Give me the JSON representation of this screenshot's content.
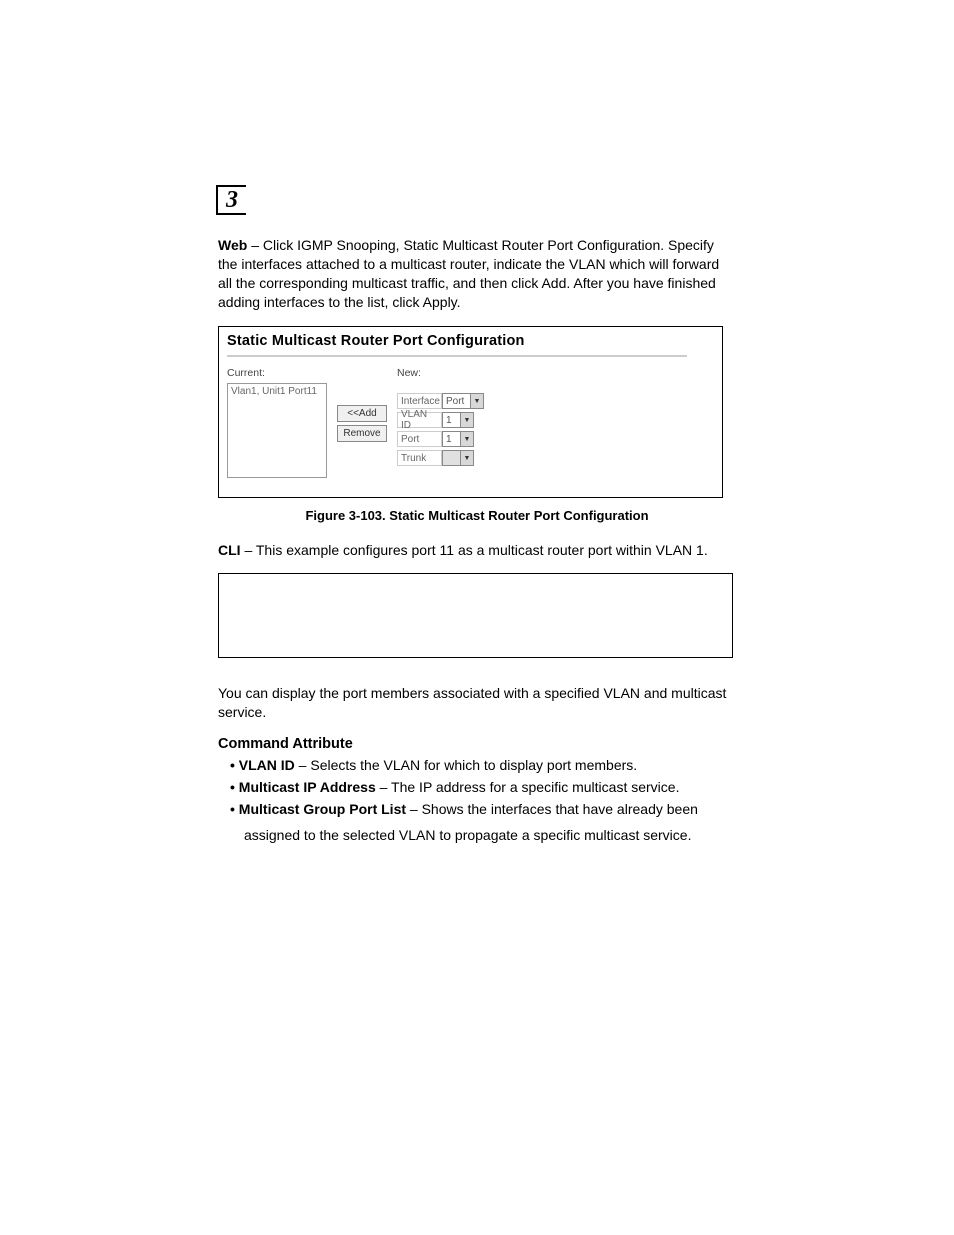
{
  "chapter_number": "3",
  "web_paragraph": {
    "prefix": "Web",
    "text": " – Click IGMP Snooping, Static Multicast Router Port Configuration. Specify the interfaces attached to a multicast router, indicate the VLAN which will forward all the corresponding multicast traffic, and then click Add. After you have finished adding interfaces to the list, click Apply."
  },
  "screenshot": {
    "title": "Static Multicast Router Port Configuration",
    "current_label": "Current:",
    "list_item": "Vlan1, Unit1 Port11",
    "add_button": "<<Add",
    "remove_button": "Remove",
    "new_label": "New:",
    "rows": {
      "interface": {
        "label": "Interface",
        "value": "Port"
      },
      "vlan_id": {
        "label": "VLAN ID",
        "value": "1"
      },
      "port": {
        "label": "Port",
        "value": "1"
      },
      "trunk": {
        "label": "Trunk",
        "value": ""
      }
    }
  },
  "figure_caption": "Figure 3-103.  Static Multicast Router Port Configuration",
  "cli_paragraph": {
    "prefix": "CLI",
    "text": " – This example configures port 11 as a multicast router port within VLAN 1."
  },
  "display_paragraph": "You can display the port members associated with a specified VLAN and multicast service.",
  "command_attribute_heading": "Command Attribute",
  "bullets": {
    "b1": {
      "label": "VLAN ID",
      "text": " – Selects the VLAN for which to display port members."
    },
    "b2": {
      "label": "Multicast IP Address",
      "text": " – The IP address for a specific multicast service."
    },
    "b3": {
      "label": "Multicast Group Port List",
      "text": " – Shows the interfaces that have already been",
      "cont": "assigned to the selected VLAN to propagate a specific multicast service."
    }
  }
}
